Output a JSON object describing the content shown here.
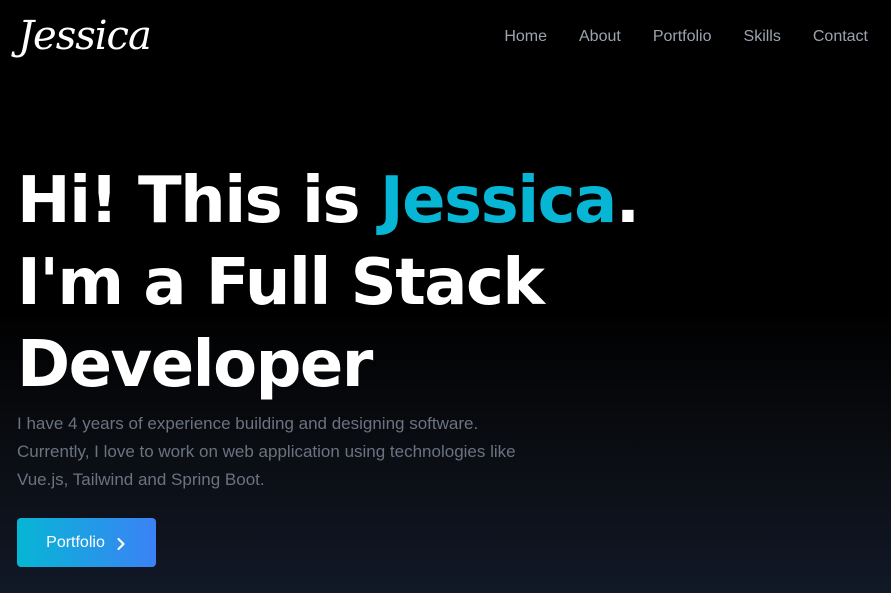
{
  "logo": {
    "text": "Jessica"
  },
  "nav": {
    "links": [
      {
        "label": "Home"
      },
      {
        "label": "About"
      },
      {
        "label": "Portfolio"
      },
      {
        "label": "Skills"
      },
      {
        "label": "Contact"
      }
    ]
  },
  "hero": {
    "greeting_prefix": "Hi! This is ",
    "name": "Jessica",
    "greeting_suffix": ".",
    "subtitle": "I'm a Full Stack Developer",
    "description": "I have 4 years of experience building and designing software. Currently, I love to work on web application using technologies like Vue.js, Tailwind and Spring Boot."
  },
  "cta": {
    "label": "Portfolio",
    "icon": "chevron-right-icon"
  },
  "colors": {
    "accent": "#06b6d4",
    "background": "#000000",
    "button_gradient_start": "#06b6d4",
    "button_gradient_end": "#3b82f6",
    "nav_text": "#9ca3af",
    "muted_text": "#6b7280"
  }
}
